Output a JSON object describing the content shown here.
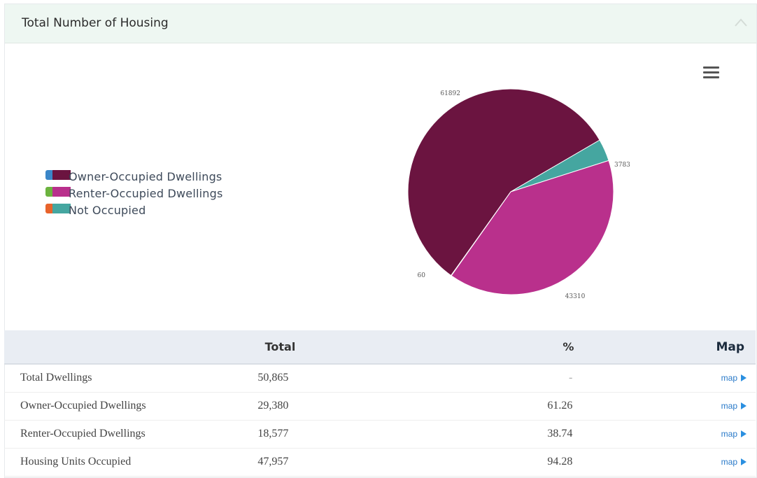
{
  "panel": {
    "title": "Total Number of Housing"
  },
  "colors": {
    "owner": "#6b1440",
    "renter": "#b9308c",
    "not_occupied": "#45a6a0",
    "legend_blue": "#3a86c8",
    "legend_green": "#6cb33f",
    "legend_orange": "#e8632b",
    "map_link": "#2a7ac9"
  },
  "legend": [
    {
      "label": "Owner-Occupied Dwellings"
    },
    {
      "label": "Renter-Occupied Dwellings"
    },
    {
      "label": "Not Occupied"
    }
  ],
  "chart_data": {
    "type": "pie",
    "title": "",
    "slices": [
      {
        "label": "Owner-Occupied Dwellings",
        "value": 61892
      },
      {
        "label": "Not Occupied",
        "value": 3783
      },
      {
        "label": "Renter-Occupied Dwellings",
        "value": 43310
      },
      {
        "label": "",
        "value": 60
      }
    ],
    "legend_position": "left"
  },
  "table": {
    "columns": [
      "",
      "Total",
      "%",
      "Map"
    ],
    "rows": [
      {
        "name": "Total Dwellings",
        "total": "50,865",
        "pct": "-",
        "map": "map"
      },
      {
        "name": "Owner-Occupied Dwellings",
        "total": "29,380",
        "pct": "61.26",
        "map": "map"
      },
      {
        "name": "Renter-Occupied Dwellings",
        "total": "18,577",
        "pct": "38.74",
        "map": "map"
      },
      {
        "name": "Housing Units Occupied",
        "total": "47,957",
        "pct": "94.28",
        "map": "map"
      }
    ]
  }
}
